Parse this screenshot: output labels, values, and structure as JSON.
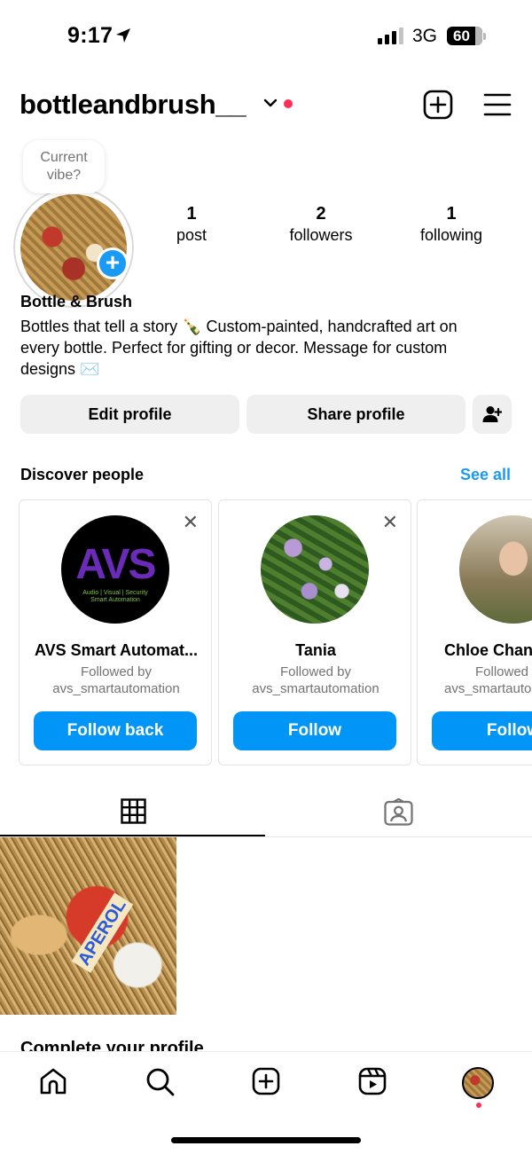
{
  "status_bar": {
    "time": "9:17",
    "network": "3G",
    "battery": "60"
  },
  "header": {
    "username": "bottleandbrush__",
    "accent_dot_color": "#ff2d55"
  },
  "profile": {
    "vibe_prompt": [
      "Current",
      "vibe?"
    ],
    "stats": [
      {
        "value": "1",
        "label": "post"
      },
      {
        "value": "2",
        "label": "followers"
      },
      {
        "value": "1",
        "label": "following"
      }
    ],
    "display_name": "Bottle & Brush",
    "bio_lines": [
      "Bottles that tell a story 🍾 Custom-painted, handcrafted art on",
      "every bottle. Perfect for gifting or decor. Message for custom",
      "designs ✉️"
    ]
  },
  "actions": {
    "edit_profile": "Edit profile",
    "share_profile": "Share profile"
  },
  "discover": {
    "title": "Discover people",
    "see_all": "See all",
    "accent_color": "#1a9af2",
    "cards": [
      {
        "name": "AVS Smart Automat...",
        "subtitle_1": "Followed by",
        "subtitle_2": "avs_smartautomation",
        "button": "Follow back",
        "logo_text": "AVS",
        "logo_tagline": "Audio | Visual | Security",
        "logo_tagline_2": "Smart Automation"
      },
      {
        "name": "Tania",
        "subtitle_1": "Followed by",
        "subtitle_2": "avs_smartautomation",
        "button": "Follow"
      },
      {
        "name": "Chloe Chan",
        "subtitle_1": "Followed",
        "subtitle_2": "avs_smartauto",
        "button": "Follow"
      }
    ]
  },
  "tabs": {
    "grid": "grid-icon",
    "tagged": "tagged-icon"
  },
  "post": {
    "label_text": "APEROL"
  },
  "complete_profile": {
    "title": "Complete your profile"
  },
  "bottom_nav": {
    "items": [
      "home-icon",
      "search-icon",
      "create-icon",
      "reels-icon",
      "profile-avatar"
    ]
  }
}
